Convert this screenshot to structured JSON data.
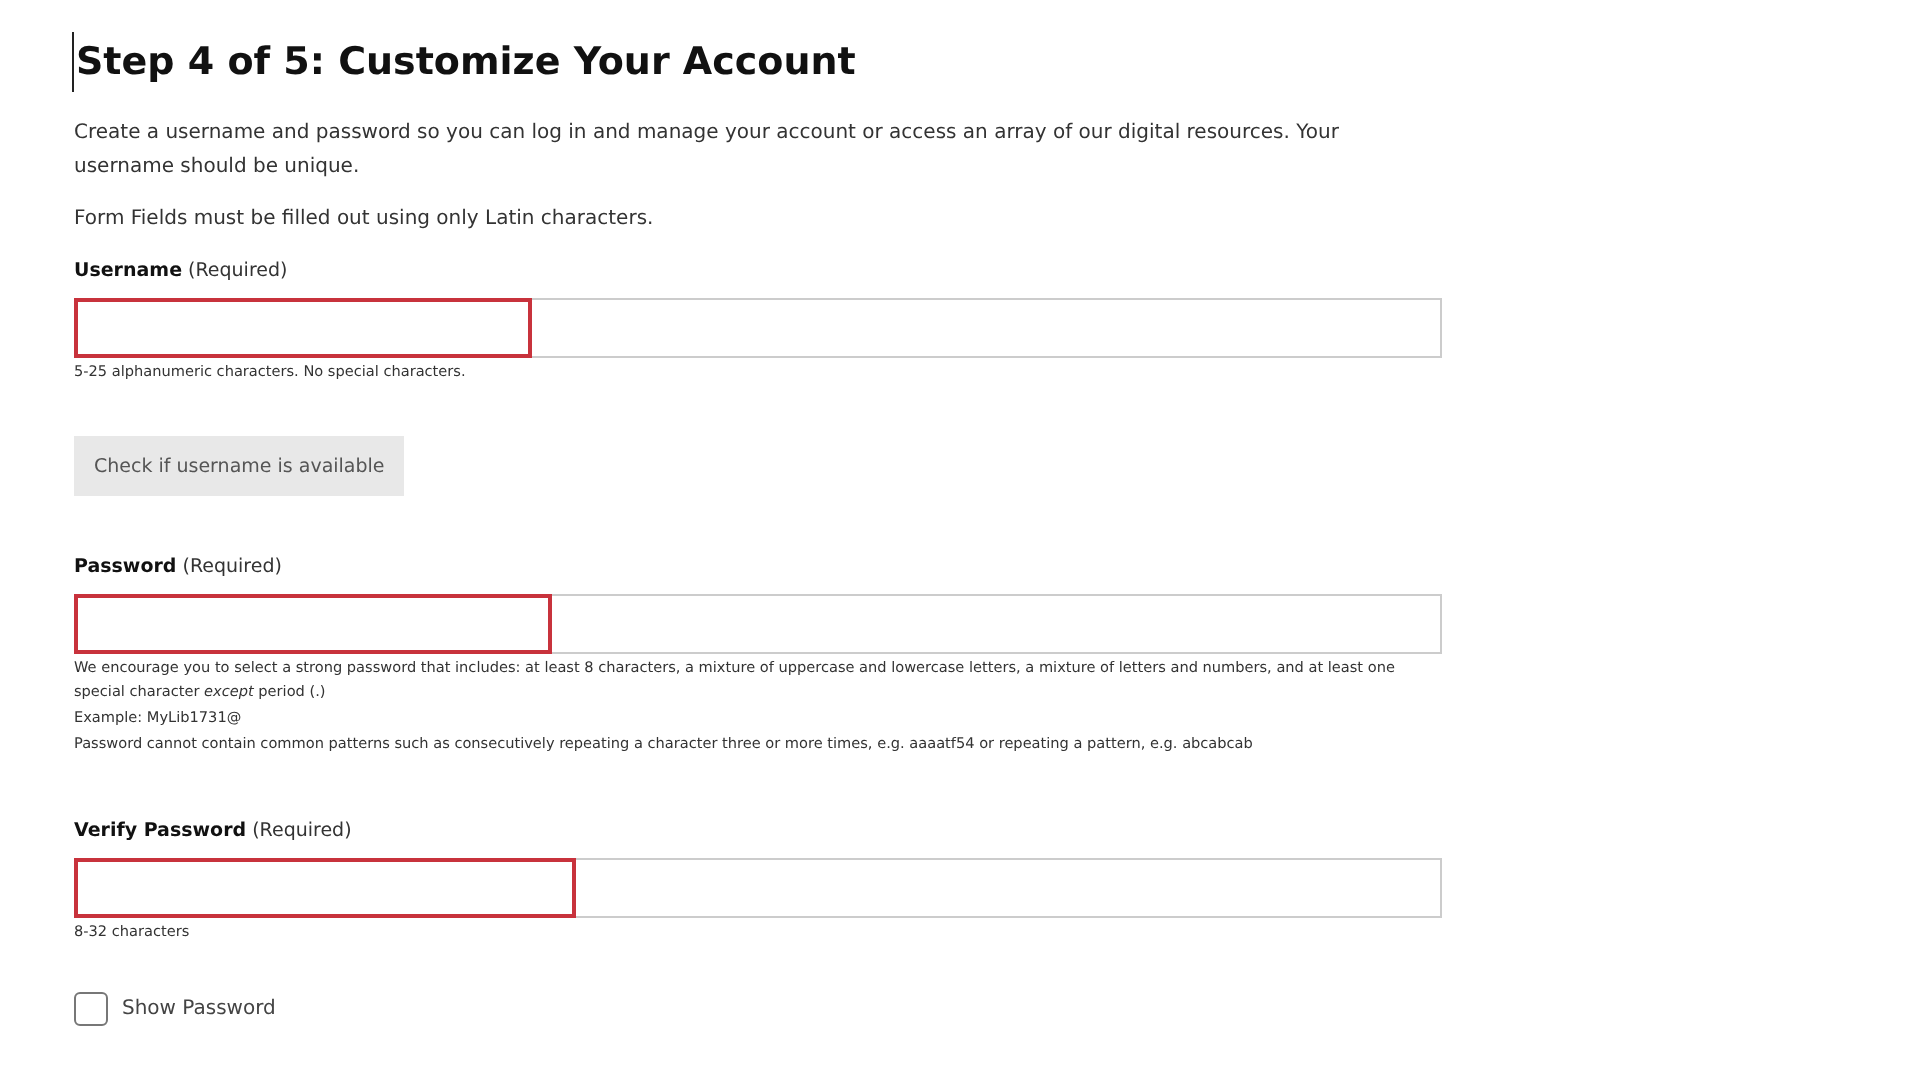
{
  "title": "Step 4 of 5: Customize Your Account",
  "intro": [
    "Create a username and password so you can log in and manage your account or access an array of our digital resources. Your username should be unique.",
    "Form Fields must be filled out using only Latin characters."
  ],
  "fields": [
    {
      "label": "Username",
      "required": "(Required)",
      "highlighted": true,
      "hints": [
        "5-25 alphanumeric characters. No special characters."
      ]
    },
    {
      "label": "Password",
      "required": "(Required)",
      "highlighted": true,
      "hints": [
        "We encourage you to select a strong password that includes: at least 8 characters, a mixture of uppercase and lowercase letters, a mixture of letters and numbers, and at least one special character *except* period (.)",
        "Example: MyLib1731@",
        "Password cannot contain common patterns such as consecutively repeating a character three or more times, e.g. aaaatf54 or repeating a pattern, e.g. abcabcab"
      ]
    },
    {
      "label": "Verify Password",
      "required": "(Required)",
      "highlighted": true,
      "hints": [
        "8-32 characters"
      ]
    }
  ],
  "check_button": {
    "label": "Check if username is available",
    "disabled": true
  },
  "show_password": {
    "label": "Show Password",
    "checked": false
  }
}
